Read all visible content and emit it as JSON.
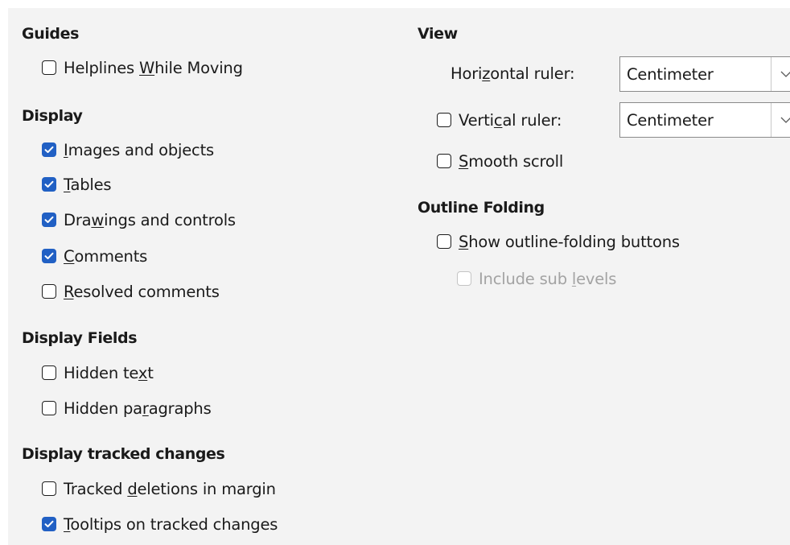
{
  "guides": {
    "heading": "Guides",
    "helplines_pre": "Helplines ",
    "helplines_key": "W",
    "helplines_post": "hile Moving",
    "helplines_checked": false
  },
  "display": {
    "heading": "Display",
    "images_pre": "",
    "images_key": "I",
    "images_post": "mages and objects",
    "images_checked": true,
    "tables_pre": "",
    "tables_key": "T",
    "tables_post": "ables",
    "tables_checked": true,
    "drawings_pre": "Dra",
    "drawings_key": "w",
    "drawings_post": "ings and controls",
    "drawings_checked": true,
    "comments_pre": "",
    "comments_key": "C",
    "comments_post": "omments",
    "comments_checked": true,
    "resolved_pre": "",
    "resolved_key": "R",
    "resolved_post": "esolved comments",
    "resolved_checked": false
  },
  "display_fields": {
    "heading": "Display Fields",
    "hidden_text_pre": "Hidden te",
    "hidden_text_key": "x",
    "hidden_text_post": "t",
    "hidden_text_checked": false,
    "hidden_paragraphs_pre": "Hidden pa",
    "hidden_paragraphs_key": "r",
    "hidden_paragraphs_post": "agraphs",
    "hidden_paragraphs_checked": false
  },
  "tracked_changes": {
    "heading": "Display tracked changes",
    "deletions_pre": "Tracked ",
    "deletions_key": "d",
    "deletions_post": "eletions in margin",
    "deletions_checked": false,
    "tooltips_pre": "",
    "tooltips_key": "T",
    "tooltips_post": "ooltips on tracked changes",
    "tooltips_checked": true
  },
  "view": {
    "heading": "View",
    "horizontal_pre": "Hori",
    "horizontal_key": "z",
    "horizontal_post": "ontal ruler:",
    "horizontal_value": "Centimeter",
    "vertical_pre": "Verti",
    "vertical_key": "c",
    "vertical_post": "al ruler:",
    "vertical_checked": false,
    "vertical_value": "Centimeter",
    "smooth_pre": "",
    "smooth_key": "S",
    "smooth_post": "mooth scroll",
    "smooth_checked": false
  },
  "outline_folding": {
    "heading": "Outline Folding",
    "show_pre": "",
    "show_key": "S",
    "show_post": "how outline-folding buttons",
    "show_checked": false,
    "sub_pre": "Include sub ",
    "sub_key": "l",
    "sub_post": "evels",
    "sub_checked": false,
    "sub_enabled": false
  },
  "icons": {
    "checkbox": "checkbox-icon",
    "checkmark": "checkmark-icon",
    "dropdown": "chevron-down-icon"
  },
  "colors": {
    "accent": "#2160c4",
    "panel_background": "#f3f3f3",
    "disabled_text": "#a3a3a3"
  }
}
